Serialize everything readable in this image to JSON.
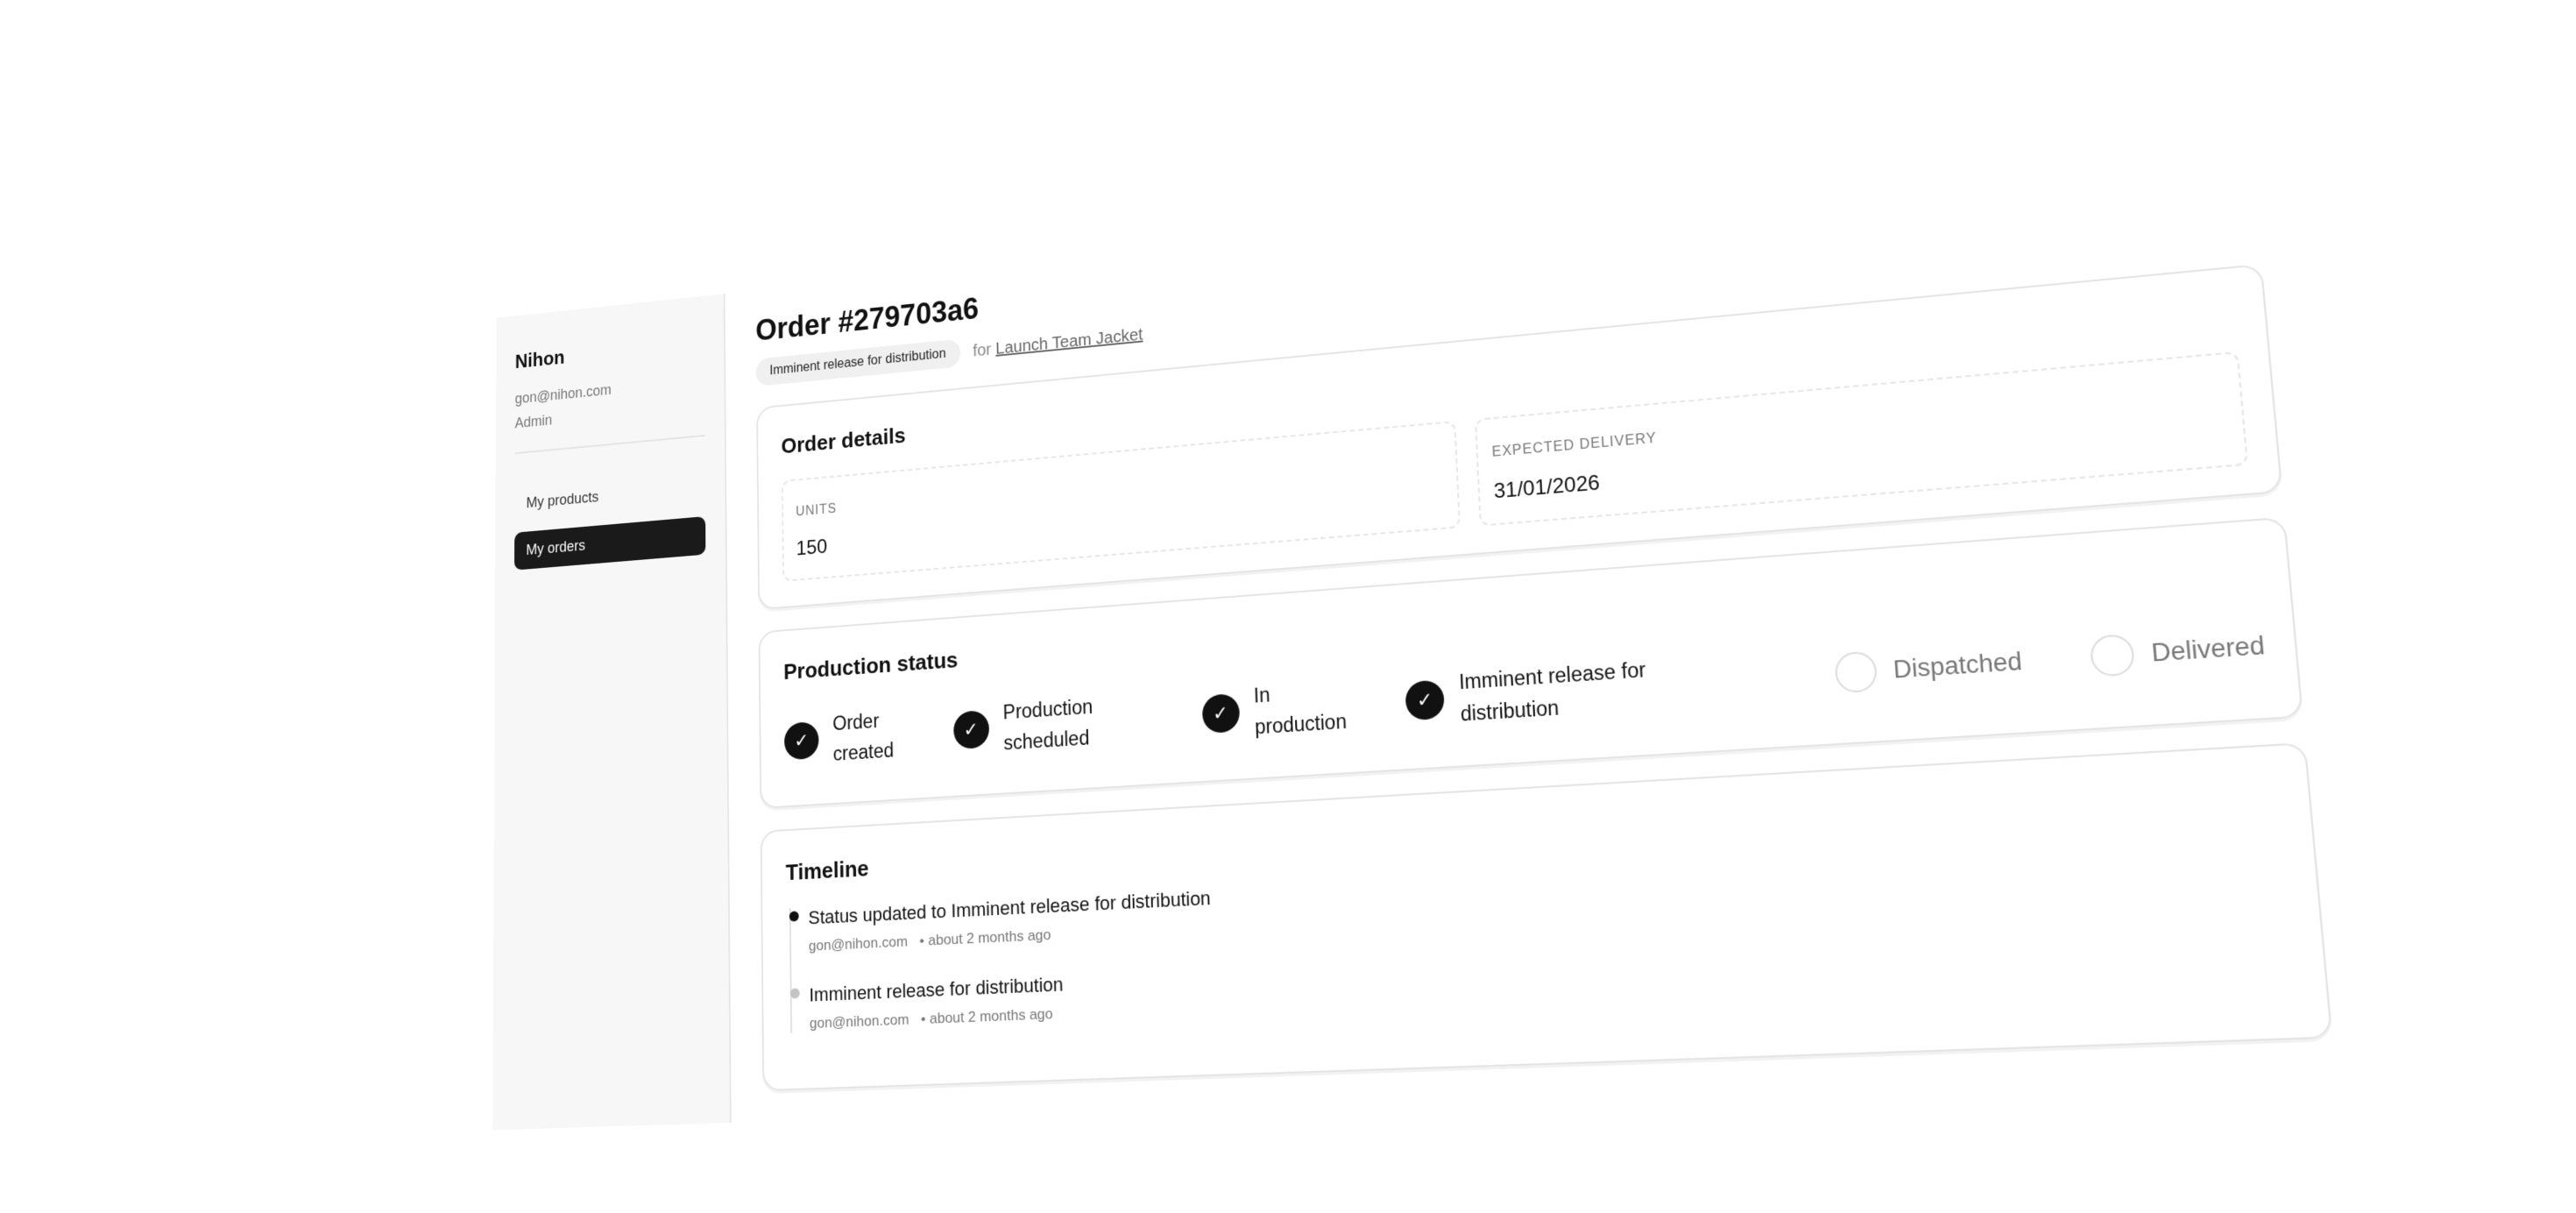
{
  "user": {
    "name": "Nihon",
    "email": "gon@nihon.com",
    "role": "Admin"
  },
  "nav": {
    "items": [
      {
        "label": "My products",
        "active": false
      },
      {
        "label": "My orders",
        "active": true
      }
    ]
  },
  "order": {
    "title": "Order #279703a6",
    "status_pill": "Imminent release for distribution",
    "for_prefix": "for",
    "product_link": "Launch Team Jacket"
  },
  "details": {
    "title": "Order details",
    "units_label": "UNITS",
    "units_value": "150",
    "delivery_label": "EXPECTED DELIVERY",
    "delivery_value": "31/01/2026"
  },
  "production": {
    "title": "Production status",
    "check_glyph": "✓",
    "steps": [
      {
        "label": "Order created",
        "done": true
      },
      {
        "label": "Production scheduled",
        "done": true
      },
      {
        "label": "In production",
        "done": true
      },
      {
        "label": "Imminent release for distribution",
        "done": true
      },
      {
        "label": "Dispatched",
        "done": false
      },
      {
        "label": "Delivered",
        "done": false
      }
    ]
  },
  "timeline": {
    "title": "Timeline",
    "entries": [
      {
        "title": "Status updated to Imminent release for distribution",
        "author": "gon@nihon.com",
        "time": "• about 2 months ago"
      },
      {
        "title": "Imminent release for distribution",
        "author": "gon@nihon.com",
        "time": "• about 2 months ago"
      }
    ]
  },
  "colors": {
    "accent": "#111111",
    "sidebar_bg": "#f7f7f7",
    "muted_text": "#777777"
  },
  "icons": {
    "step_done": "check-icon",
    "timeline_marker": "dot-icon"
  }
}
